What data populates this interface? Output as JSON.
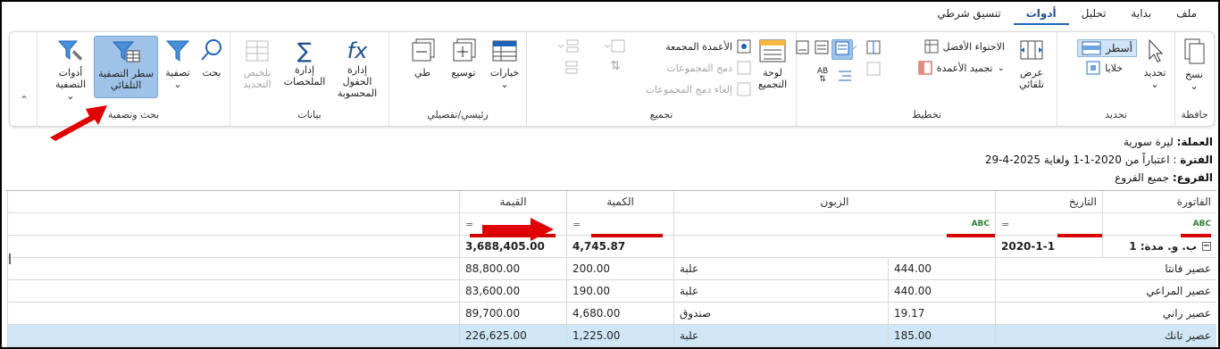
{
  "menu": {
    "items": [
      "ملف",
      "بداية",
      "تحليل",
      "أدوات",
      "تنسيق شرطي"
    ],
    "active_index": 3
  },
  "ribbon": {
    "clipboard": {
      "label": "حافظة",
      "copy": "نسخ"
    },
    "selection": {
      "label": "تحديد",
      "select": "تحديد",
      "rows": "أسطر",
      "cells": "خلايا"
    },
    "layout": {
      "label": "تخطيط",
      "autowidth": "عرض تلقائي",
      "bestfit": "الاحتواء الأفضل",
      "freeze": "تجميد الأعمدة"
    },
    "grouping": {
      "label": "تجميع",
      "panel": "لوحة التجميع",
      "grouped_cols": "الأعمدة المجمعة",
      "merge": "دمج المجموعات",
      "unmerge": "إلغاء دمج المجموعات"
    },
    "master": {
      "label": "رئيسي/تفصيلي",
      "options": "خيارات",
      "expand": "توسيع",
      "collapse": "طي"
    },
    "data": {
      "label": "بيانات",
      "calc_fields": "إدارة الحقول المحسوبة",
      "summaries": "إدارة الملخصات",
      "summary_selection": "تلخيص التحديد"
    },
    "search": {
      "label": "بحث وتصفية",
      "search": "بحث",
      "filter": "تصفية",
      "auto_filter_row": "سطر التصفية التلقائي",
      "filter_tools": "أدوات التصفية"
    }
  },
  "info": {
    "currency_label": "العملة:",
    "currency_value": " ليرة سورية",
    "period_label": "الفترة",
    "period_value": " : اعتباراً من 2020-1-1 ولغاية 2025-4-29",
    "branches_label": "الفروع:",
    "branches_value": " جميع الفروع"
  },
  "grid": {
    "headers": {
      "invoice": "الفاتورة",
      "date": "التاريخ",
      "customer": "الزبون",
      "qty": "الكمية",
      "value": "القيمة"
    },
    "filter_eq": "=",
    "filter_abc": "ABC",
    "group_row": {
      "invoice": "ب. و. مدة: 1",
      "date": "2020-1-1",
      "qty": "4,745.87",
      "value": "3,688,405.00"
    },
    "rows": [
      {
        "invoice": "عصير فانتا",
        "date": "444.00",
        "unit": "علبة",
        "qty": "200.00",
        "value": "88,800.00"
      },
      {
        "invoice": "عصير المراعي",
        "date": "440.00",
        "unit": "علبة",
        "qty": "190.00",
        "value": "83,600.00"
      },
      {
        "invoice": "عصير راني",
        "date": "19.17",
        "unit": "صندوق",
        "qty": "4,680.00",
        "value": "89,700.00"
      },
      {
        "invoice": "عصير تانك",
        "date": "185.00",
        "unit": "علبة",
        "qty": "1,225.00",
        "value": "226,625.00"
      }
    ]
  },
  "colors": {
    "accent": "#1e63b8",
    "selected": "#9fc3e8",
    "highlight": "#d40000",
    "selected_row": "#cfe6f7"
  }
}
